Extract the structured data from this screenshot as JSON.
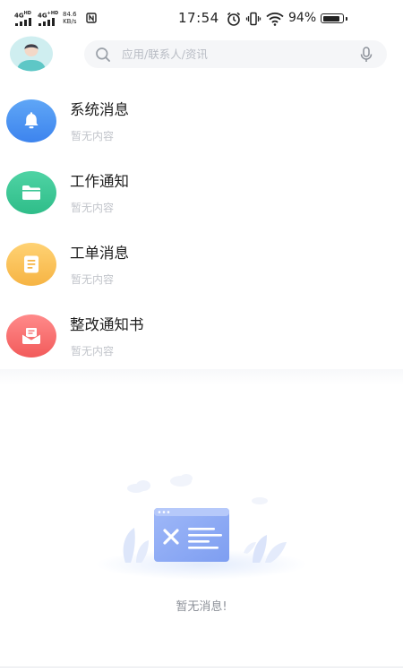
{
  "status_bar": {
    "sim1": "4G",
    "sim1_hd": "HD",
    "sim2": "4G",
    "sim2_hd": "+HD",
    "speed_value": "84.6",
    "speed_unit": "KB/s",
    "time": "17:54",
    "battery_percent": "94%",
    "battery_level": 0.94,
    "icons": [
      "signal-icon",
      "nfc-icon",
      "alarm-icon",
      "vibrate-icon",
      "wifi-icon",
      "battery-icon"
    ]
  },
  "header": {
    "avatar": "avatar",
    "search": {
      "placeholder": "应用/联系人/资讯",
      "value": "",
      "left_icon": "search-icon",
      "right_icon": "mic-icon"
    }
  },
  "messages": [
    {
      "title": "系统消息",
      "subtitle": "暂无内容",
      "icon": "bell-icon",
      "color_from": "#5fa6f6",
      "color_to": "#3d84ee"
    },
    {
      "title": "工作通知",
      "subtitle": "暂无内容",
      "icon": "folder-icon",
      "color_from": "#4fd3a4",
      "color_to": "#2fbd89"
    },
    {
      "title": "工单消息",
      "subtitle": "暂无内容",
      "icon": "document-icon",
      "color_from": "#ffd274",
      "color_to": "#f6b444"
    },
    {
      "title": "整改通知书",
      "subtitle": "暂无内容",
      "icon": "mail-icon",
      "color_from": "#ff8a8a",
      "color_to": "#f25b5b"
    }
  ],
  "empty_state": {
    "text": "暂无消息!",
    "illustration": "empty-message-illustration"
  }
}
